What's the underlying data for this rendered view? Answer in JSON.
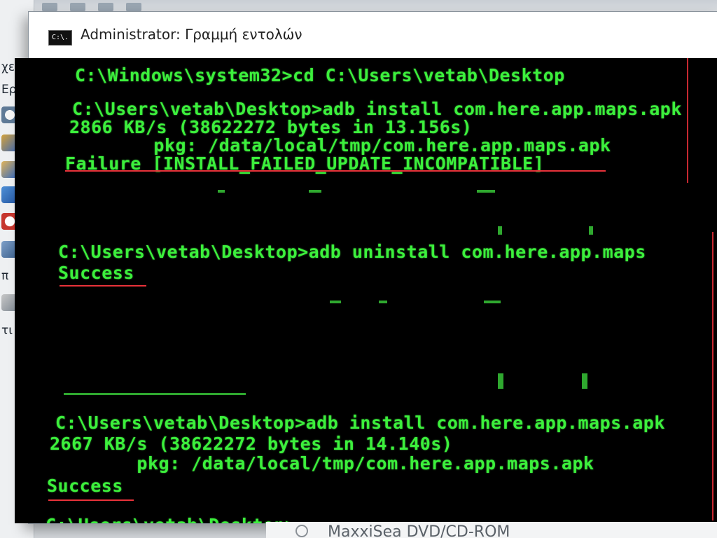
{
  "window": {
    "title": "Administrator: Γραμμή εντολών",
    "icon_label": "C:\\."
  },
  "background": {
    "left_fragments": [
      "χείρ",
      "Εργ",
      "π",
      "τι"
    ],
    "bottom_text": "MaxxiSea DVD/CD-ROM"
  },
  "console": {
    "lines": [
      "C:\\Windows\\system32>cd C:\\Users\\vetab\\Desktop",
      "C:\\Users\\vetab\\Desktop>adb install com.here.app.maps.apk",
      "2866 KB/s (38622272 bytes in 13.156s)",
      "        pkg: /data/local/tmp/com.here.app.maps.apk",
      "Failure [INSTALL_FAILED_UPDATE_INCOMPATIBLE]",
      "C:\\Users\\vetab\\Desktop>adb uninstall com.here.app.maps",
      "Success",
      "C:\\Users\\vetab\\Desktop>adb install com.here.app.maps.apk",
      "2667 KB/s (38622272 bytes in 14.140s)",
      "        pkg: /data/local/tmp/com.here.app.maps.apk",
      "Success",
      "C:\\Users\\vetab\\Desktop>"
    ]
  },
  "colors": {
    "console_text": "#3cf03c",
    "console_bg": "#000000",
    "annotation": "#e8323a"
  },
  "icons": [
    "cmd-icon",
    "clock-icon",
    "folder-icon",
    "user-icon",
    "monitor-icon",
    "help-icon",
    "cdrom-icon"
  ]
}
